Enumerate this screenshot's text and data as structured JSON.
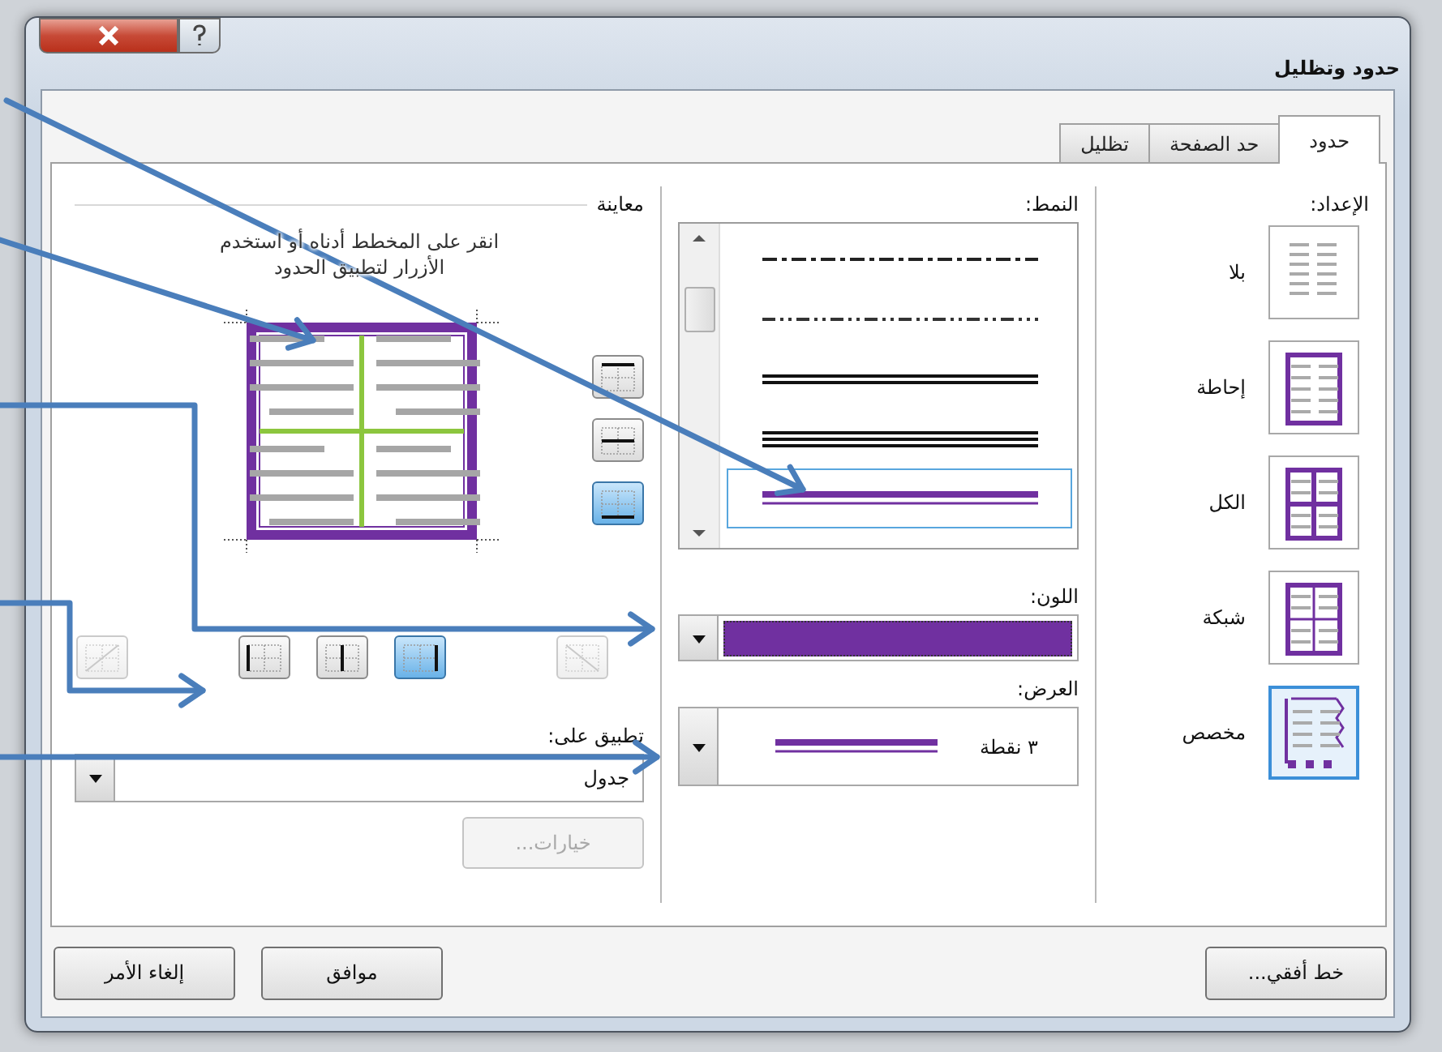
{
  "window": {
    "title": "حدود وتظليل"
  },
  "tabs": [
    {
      "label": "حدود",
      "selected": true
    },
    {
      "label": "حد الصفحة",
      "selected": false
    },
    {
      "label": "تظليل",
      "selected": false
    }
  ],
  "setting": {
    "label": "الإعداد:",
    "items": [
      {
        "label": "بلا",
        "kind": "none",
        "selected": false
      },
      {
        "label": "إحاطة",
        "kind": "box",
        "selected": false
      },
      {
        "label": "الكل",
        "kind": "all",
        "selected": false
      },
      {
        "label": "شبكة",
        "kind": "grid",
        "selected": false
      },
      {
        "label": "مخصص",
        "kind": "custom",
        "selected": true
      }
    ]
  },
  "style": {
    "label": "النمط:",
    "items": [
      {
        "kind": "dash-dot",
        "selected": false
      },
      {
        "kind": "dash-dot-dot",
        "selected": false
      },
      {
        "kind": "double",
        "selected": false
      },
      {
        "kind": "triple",
        "selected": false
      },
      {
        "kind": "thick-thin",
        "selected": true
      }
    ]
  },
  "color": {
    "label": "اللون:",
    "color": "#7030a0"
  },
  "width": {
    "label": "العرض:",
    "value": "٣ نقطة"
  },
  "preview": {
    "label": "معاينة",
    "hint": "انقر على المخطط أدناه أو استخدم الأزرار لتطبيق الحدود",
    "side_buttons": [
      {
        "kind": "top",
        "on": false,
        "disabled": false
      },
      {
        "kind": "inside-horizontal",
        "on": false,
        "disabled": false
      },
      {
        "kind": "bottom",
        "on": true,
        "disabled": false
      }
    ],
    "bottom_buttons": [
      {
        "kind": "diagonal-down",
        "on": false,
        "disabled": true
      },
      {
        "kind": "right",
        "on": true,
        "disabled": false
      },
      {
        "kind": "inside-vertical",
        "on": false,
        "disabled": false
      },
      {
        "kind": "left",
        "on": false,
        "disabled": false
      },
      {
        "kind": "diagonal-up",
        "on": false,
        "disabled": true
      }
    ]
  },
  "apply_to": {
    "label": "تطبيق على:",
    "value": "جدول"
  },
  "options_button": {
    "label": "خيارات...",
    "disabled": true
  },
  "footer_buttons": [
    {
      "label": "خط أفقي..."
    },
    {
      "label": "موافق"
    },
    {
      "label": "إلغاء الأمر"
    }
  ]
}
